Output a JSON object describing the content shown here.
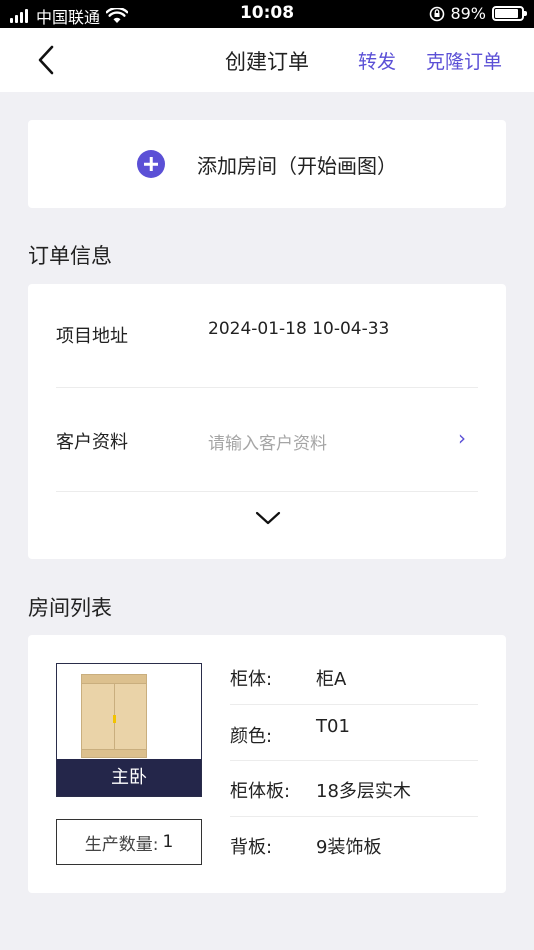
{
  "status_bar": {
    "carrier": "中国联通",
    "time": "10:08",
    "battery": "89%",
    "battery_level": 0.89
  },
  "nav": {
    "title": "创建订单",
    "forward_label": "转发",
    "clone_label": "克隆订单"
  },
  "add_room": {
    "label": "添加房间（开始画图）"
  },
  "order_info": {
    "section_title": "订单信息",
    "address_label": "项目地址",
    "address_value": "2024-01-18 10-04-33",
    "customer_label": "客户资料",
    "customer_placeholder": "请输入客户资料",
    "chevron": "›"
  },
  "rooms": {
    "section_title": "房间列表",
    "items": [
      {
        "name": "主卧",
        "quantity_label": "生产数量:",
        "quantity": "1",
        "specs": [
          {
            "label": "柜体:",
            "value": "柜A"
          },
          {
            "label": "颜色:",
            "value": "T01"
          },
          {
            "label": "柜体板:",
            "value": "18多层实木"
          },
          {
            "label": "背板:",
            "value": "9装饰板"
          }
        ]
      }
    ]
  },
  "colors": {
    "accent": "#5b50d6",
    "room_label_bg": "#24264a",
    "page_bg": "#f0f0f4"
  }
}
